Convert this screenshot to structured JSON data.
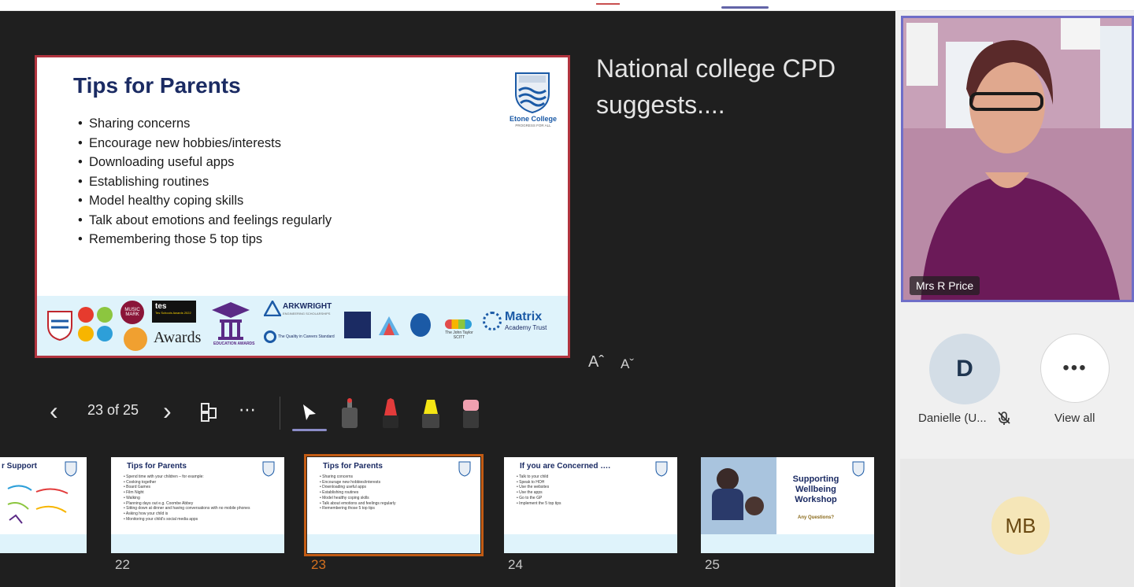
{
  "slide": {
    "title": "Tips for Parents",
    "bullets": [
      "Sharing concerns",
      "Encourage new hobbies/interests",
      "Downloading useful apps",
      "Establishing routines",
      "Model healthy coping skills",
      "Talk about emotions and feelings regularly",
      "Remembering those 5 top tips"
    ],
    "school_name": "Etone College",
    "school_motto": "PROGRESS FOR ALL",
    "logos": {
      "music_mark": "MUSIC MARK",
      "tes": "tes",
      "tes_sub": "Tes Schools Awards 2022",
      "awards": "Awards",
      "education_awards": "EDUCATION AWARDS",
      "arkwright": "ARKWRIGHT",
      "arkwright_sub": "ENGINEERING SCHOLARSHIPS",
      "quality": "The Quality in Careers Standard",
      "john_taylor": "The John Taylor SCITT",
      "matrix": "Matrix",
      "matrix_sub": "Academy Trust"
    }
  },
  "notes": {
    "text": "National college CPD suggests...."
  },
  "font_controls": {
    "increase": "Aˆ",
    "decrease": "Aˇ"
  },
  "toolbar": {
    "counter": "23 of 25",
    "prev": "‹",
    "next": "›",
    "more": "⋯"
  },
  "thumbnails": [
    {
      "number": "",
      "title": "r Support"
    },
    {
      "number": "22",
      "title": "Tips for Parents",
      "lines": [
        "• Spend time with your children – for example:",
        "   • Cooking together",
        "   • Board Games",
        "   • Film Night",
        "   • Walking",
        "• Planning days out e.g. Coombe Abbey",
        "• Sitting down at dinner and having conversations with no mobile phones",
        "• Asking how your child is",
        "• Monitoring your child's social media apps"
      ]
    },
    {
      "number": "23",
      "title": "Tips for Parents",
      "lines": [
        "• Sharing concerns",
        "• Encourage new hobbies/interests",
        "• Downloading useful apps",
        "• Establishing routines",
        "• Model healthy coping skills",
        "• Talk about emotions and feelings regularly",
        "• Remembering those 5 top tips"
      ]
    },
    {
      "number": "24",
      "title": "If you are Concerned ….",
      "lines": [
        "• Talk to your child",
        "• Speak to HOH",
        "• Use the websites",
        "• Use the apps",
        "• Go to the GP",
        "• Implement the 5 top tips"
      ]
    },
    {
      "number": "25",
      "title": "Supporting Wellbeing Workshop",
      "subtitle": "Any Questions?"
    }
  ],
  "participants": {
    "presenter": "Mrs R Price",
    "danielle_initial": "D",
    "danielle_label": "Danielle (U...",
    "view_all": "View all",
    "view_all_icon": "•••",
    "mb_initials": "MB"
  },
  "colors": {
    "slide_border": "#b1343f",
    "active_thumb": "#c25b14",
    "presenter_border": "#6f6ec8",
    "title_navy": "#1b2b63"
  }
}
